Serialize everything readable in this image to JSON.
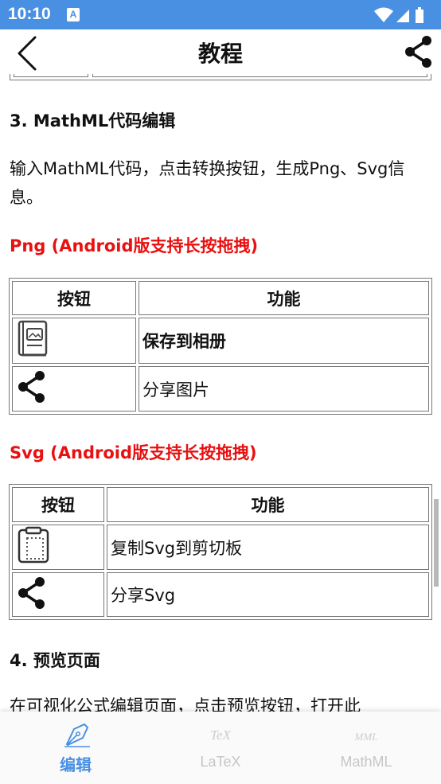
{
  "status_bar": {
    "time": "10:10",
    "notification_letter": "A"
  },
  "app_bar": {
    "title": "教程",
    "back_icon": "back-chevron-icon",
    "share_icon": "share-icon"
  },
  "content": {
    "section3_heading": "3. MathML代码编辑",
    "section3_paragraph": "输入MathML代码，点击转换按钮，生成Png、Svg信息。",
    "png_heading": "Png (Android版支持长按拖拽)",
    "png_table": {
      "header_button": "按钮",
      "header_function": "功能",
      "rows": [
        {
          "icon": "album-book-icon",
          "function": "保存到相册"
        },
        {
          "icon": "share-icon",
          "function": "分享图片"
        }
      ]
    },
    "svg_heading": "Svg (Android版支持长按拖拽)",
    "svg_table": {
      "header_button": "按钮",
      "header_function": "功能",
      "rows": [
        {
          "icon": "clipboard-icon",
          "function": "复制Svg到剪切板"
        },
        {
          "icon": "share-icon",
          "function": "分享Svg"
        }
      ]
    },
    "section4_heading": "4. 预览页面",
    "section4_paragraph": "在可视化公式编辑页面，点击预览按钮，打开此"
  },
  "bottom_nav": {
    "items": [
      {
        "label": "编辑",
        "icon": "pen-nib-icon",
        "active": true
      },
      {
        "label": "LaTeX",
        "icon_text": "TeX",
        "active": false
      },
      {
        "label": "MathML",
        "icon_text": "MML",
        "active": false
      }
    ]
  },
  "colors": {
    "accent": "#4a90e2",
    "heading_red": "#e81010"
  }
}
